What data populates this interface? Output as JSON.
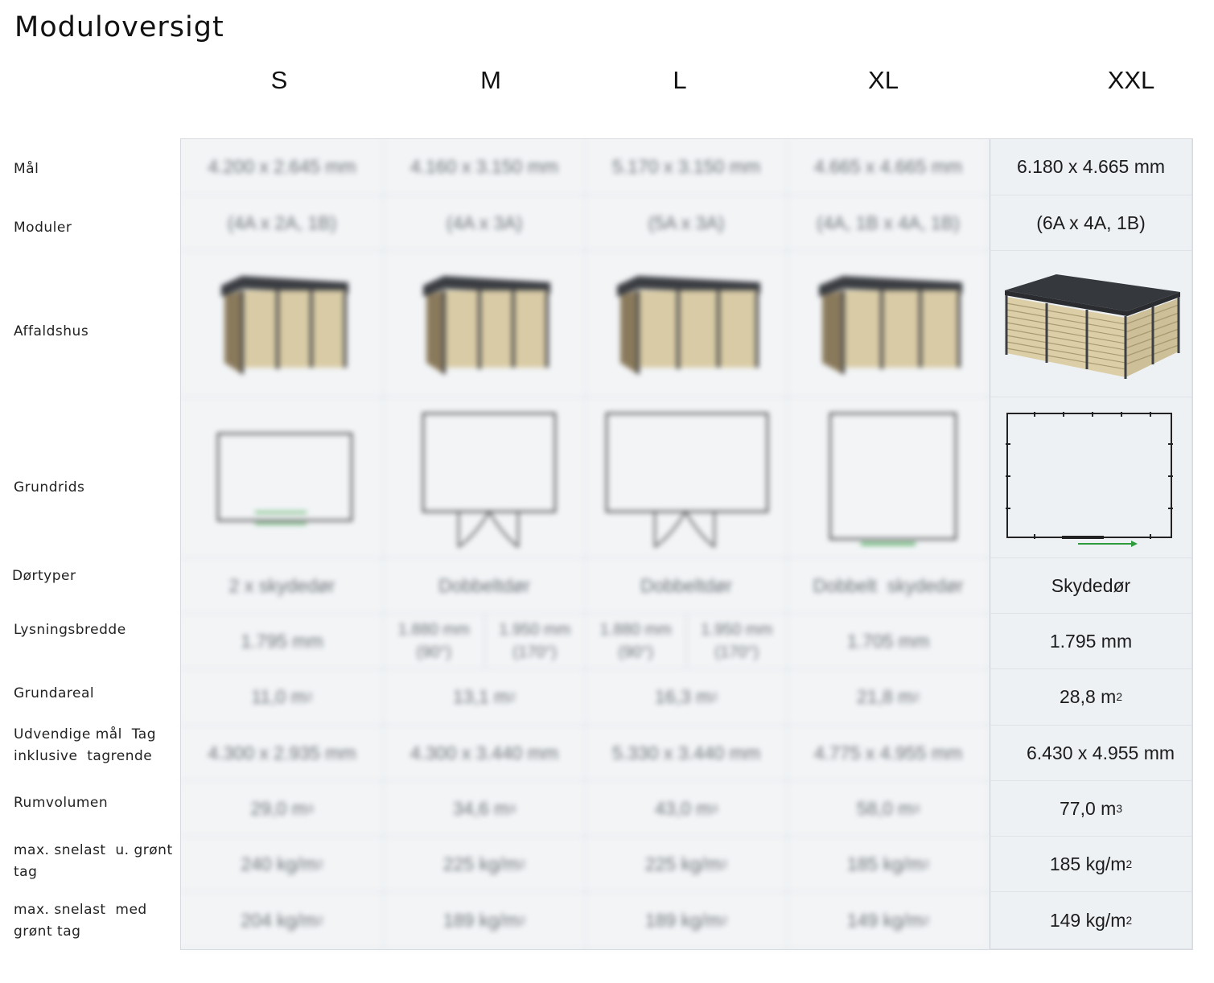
{
  "title": "Moduloversigt",
  "columns": [
    "S",
    "M",
    "L",
    "XL",
    "XXL"
  ],
  "row_labels": {
    "mal": "Mål",
    "moduler": "Moduler",
    "affaldshus": "Affaldshus",
    "grundrids": "Grundrids",
    "dortyper": "Dørtyper",
    "lysningsbredde": "Lysningsbredde",
    "grundareal": "Grundareal",
    "udvendige_l1": "Udvendige mål  Tag",
    "udvendige_l2": "inklusive  tagrende",
    "rumvolumen": "Rumvolumen",
    "snelast_u_l1": "max. snelast  u. grønt",
    "snelast_u_l2": "tag",
    "snelast_m_l1": "max. snelast  med",
    "snelast_m_l2": "grønt tag"
  },
  "S": {
    "mal": "4.200 x 2.645 mm",
    "moduler": "(4A x 2A, 1B)",
    "dortyper": "2 x skydedør",
    "lysningsbredde": "1.795 mm",
    "grundareal": "11,0 m",
    "udvendige": "4.300 x 2.935 mm",
    "rumvolumen": "29,0 m",
    "snelast_u": "240 kg/m",
    "snelast_m": "204 kg/m"
  },
  "M": {
    "mal": "4.160 x 3.150 mm",
    "moduler": "(4A x 3A)",
    "dortyper": "Dobbeltdør",
    "lys_a": "1.880 mm (90°)",
    "lys_b": "1.950 mm (170°)",
    "grundareal": "13,1 m",
    "udvendige": "4.300 x 3.440 mm",
    "rumvolumen": "34,6 m",
    "snelast_u": "225 kg/m",
    "snelast_m": "189 kg/m"
  },
  "L": {
    "mal": "5.170 x 3.150 mm",
    "moduler": "(5A x 3A)",
    "dortyper": "Dobbeltdør",
    "lys_a": "1.880 mm (90°)",
    "lys_b": "1.950 mm (170°)",
    "grundareal": "16,3 m",
    "udvendige": "5.330 x 3.440 mm",
    "rumvolumen": "43,0 m",
    "snelast_u": "225 kg/m",
    "snelast_m": "189 kg/m"
  },
  "XL": {
    "mal": "4.665 x 4.665 mm",
    "moduler": "(4A, 1B x 4A, 1B)",
    "dortyper": "Dobbelt  skydedør",
    "lysningsbredde": "1.705 mm",
    "grundareal": "21,8 m",
    "udvendige": "4.775 x 4.955 mm",
    "rumvolumen": "58,0 m",
    "snelast_u": "185 kg/m",
    "snelast_m": "149 kg/m"
  },
  "XXL": {
    "mal": "6.180 x 4.665 mm",
    "moduler": "(6A x 4A, 1B)",
    "dortyper": "Skydedør",
    "lysningsbredde": "1.795 mm",
    "grundareal": "28,8 m",
    "udvendige": "6.430 x 4.955 mm",
    "rumvolumen": "77,0 m",
    "snelast_u": "185 kg/m",
    "snelast_m": "149 kg/m"
  },
  "sup_area": "2",
  "sup_volume": "3",
  "colors": {
    "grid_bg": "#f2f4f6",
    "border": "#dfe3e8",
    "roof": "#3a3d42",
    "wood": "#d8cba5",
    "frame": "#4a4a4a",
    "arrow": "#2e9b3c"
  }
}
